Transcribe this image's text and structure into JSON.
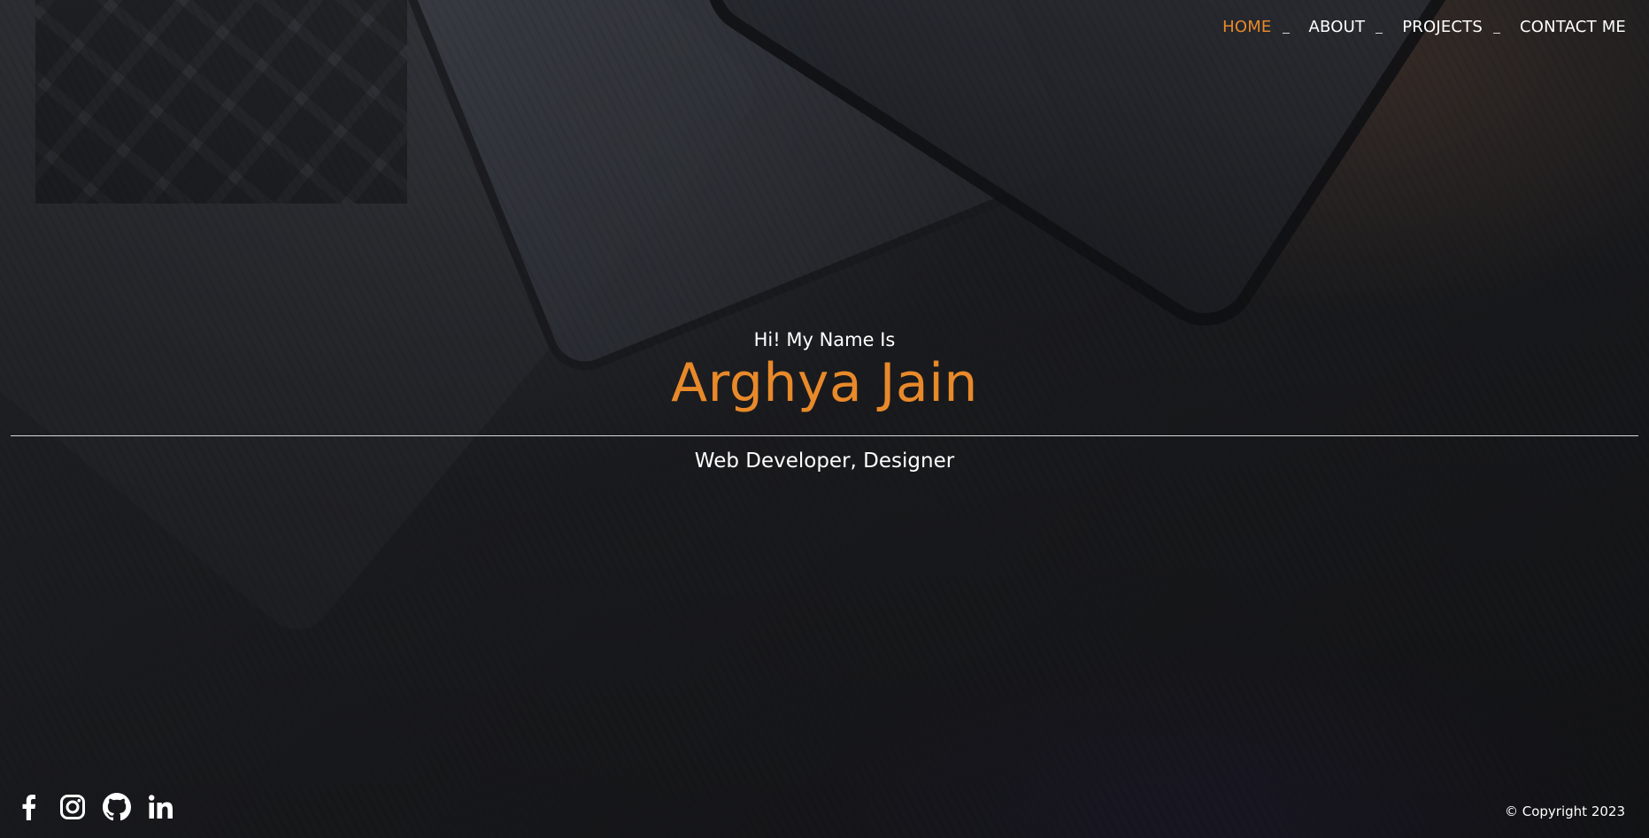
{
  "nav": {
    "items": [
      {
        "label": "HOME",
        "active": true
      },
      {
        "label": "ABOUT",
        "active": false
      },
      {
        "label": "PROJECTS",
        "active": false
      },
      {
        "label": "CONTACT ME",
        "active": false
      }
    ]
  },
  "hero": {
    "greeting": "Hi! My Name Is",
    "name": "Arghya Jain",
    "role": "Web Developer, Designer"
  },
  "footer": {
    "socials": [
      {
        "icon": "facebook-icon"
      },
      {
        "icon": "instagram-icon"
      },
      {
        "icon": "github-icon"
      },
      {
        "icon": "linkedin-icon"
      }
    ],
    "copyright": "© Copyright 2023"
  },
  "colors": {
    "accent": "#e8892a",
    "text": "#ffffff",
    "background": "#1f2023"
  }
}
